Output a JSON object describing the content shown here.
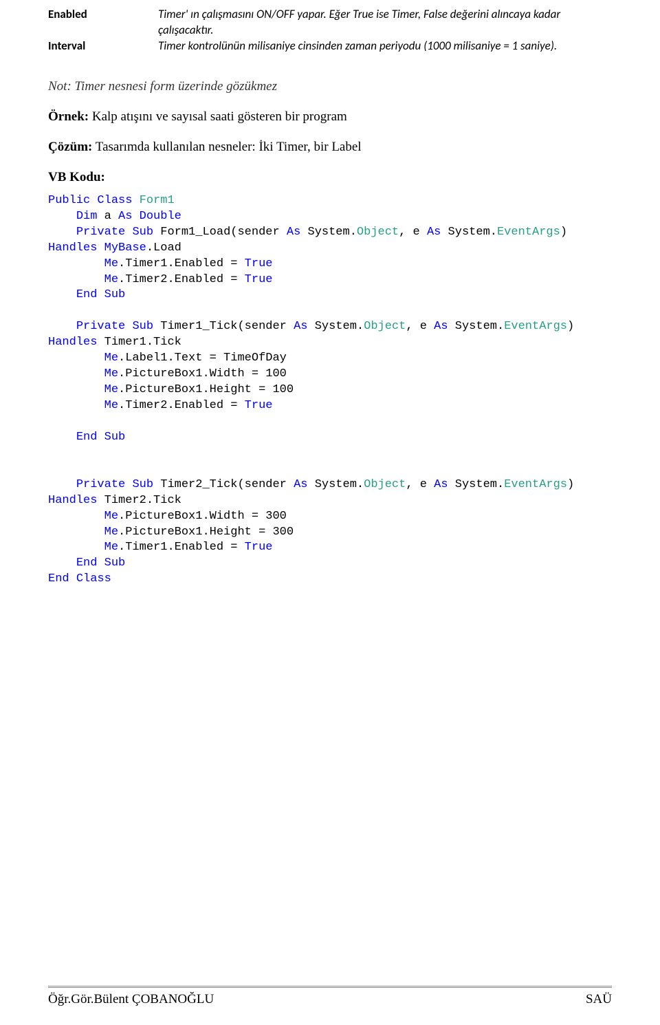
{
  "properties": [
    {
      "name": "Enabled",
      "desc": "Timer' ın çalışmasını ON/OFF yapar. Eğer True ise Timer, False değerini alıncaya kadar çalışacaktır."
    },
    {
      "name": "Interval",
      "desc": "Timer kontrolünün milisaniye cinsinden zaman periyodu (1000 milisaniye = 1 saniye)."
    }
  ],
  "note": "Not: Timer nesnesi form üzerinde gözükmez",
  "example_label": "Örnek:",
  "example_text": " Kalp atışını ve sayısal saati gösteren bir program",
  "solution_label": "Çözüm:",
  "solution_text": " Tasarımda kullanılan nesneler: İki Timer, bir Label",
  "vbkodu_label": "VB Kodu:",
  "code": {
    "l1a": "Public",
    "l1b": " ",
    "l1c": "Class",
    "l1d": " ",
    "l1e": "Form1",
    "l2a": "    ",
    "l2b": "Dim",
    "l2c": " a ",
    "l2d": "As",
    "l2e": " ",
    "l2f": "Double",
    "l3a": "    ",
    "l3b": "Private",
    "l3c": " ",
    "l3d": "Sub",
    "l3e": " Form1_Load(sender ",
    "l3f": "As",
    "l3g": " System.",
    "l3h": "Object",
    "l3i": ", e ",
    "l3j": "As",
    "l3k": " System.",
    "l3l": "EventArgs",
    "l3m": ") ",
    "l3n": "Handles",
    "l4a": " MyBase",
    "l4b": ".Load",
    "l5a": "        ",
    "l5b": "Me",
    "l5c": ".Timer1.Enabled = ",
    "l5d": "True",
    "l6a": "        ",
    "l6b": "Me",
    "l6c": ".Timer2.Enabled = ",
    "l6d": "True",
    "l7a": "    ",
    "l7b": "End",
    "l7c": " ",
    "l7d": "Sub",
    "l8": "",
    "l9a": "    ",
    "l9b": "Private",
    "l9c": " ",
    "l9d": "Sub",
    "l9e": " Timer1_Tick(sender ",
    "l9f": "As",
    "l9g": " System.",
    "l9h": "Object",
    "l9i": ", e ",
    "l9j": "As",
    "l9k": " System.",
    "l9l": "EventArgs",
    "l9m": ") ",
    "l9n": "Handles",
    "l10a": " Timer1.Tick",
    "l11a": "        ",
    "l11b": "Me",
    "l11c": ".Label1.Text = TimeOfDay",
    "l12a": "        ",
    "l12b": "Me",
    "l12c": ".PictureBox1.Width = 100",
    "l13a": "        ",
    "l13b": "Me",
    "l13c": ".PictureBox1.Height = 100",
    "l14a": "        ",
    "l14b": "Me",
    "l14c": ".Timer2.Enabled = ",
    "l14d": "True",
    "l15": "",
    "l16a": "    ",
    "l16b": "End",
    "l16c": " ",
    "l16d": "Sub",
    "l17": "",
    "l18": "",
    "l19a": "    ",
    "l19b": "Private",
    "l19c": " ",
    "l19d": "Sub",
    "l19e": " Timer2_Tick(sender ",
    "l19f": "As",
    "l19g": " System.",
    "l19h": "Object",
    "l19i": ", e ",
    "l19j": "As",
    "l19k": " System.",
    "l19l": "EventArgs",
    "l19m": ") ",
    "l19n": "Handles",
    "l20a": " Timer2.Tick",
    "l21a": "        ",
    "l21b": "Me",
    "l21c": ".PictureBox1.Width = 300",
    "l22a": "        ",
    "l22b": "Me",
    "l22c": ".PictureBox1.Height = 300",
    "l23a": "        ",
    "l23b": "Me",
    "l23c": ".Timer1.Enabled = ",
    "l23d": "True",
    "l24a": "    ",
    "l24b": "End",
    "l24c": " ",
    "l24d": "Sub",
    "l25a": "End",
    "l25b": " ",
    "l25c": "Class"
  },
  "footer_left": "Öğr.Gör.Bülent ÇOBANOĞLU",
  "footer_right": "SAÜ"
}
